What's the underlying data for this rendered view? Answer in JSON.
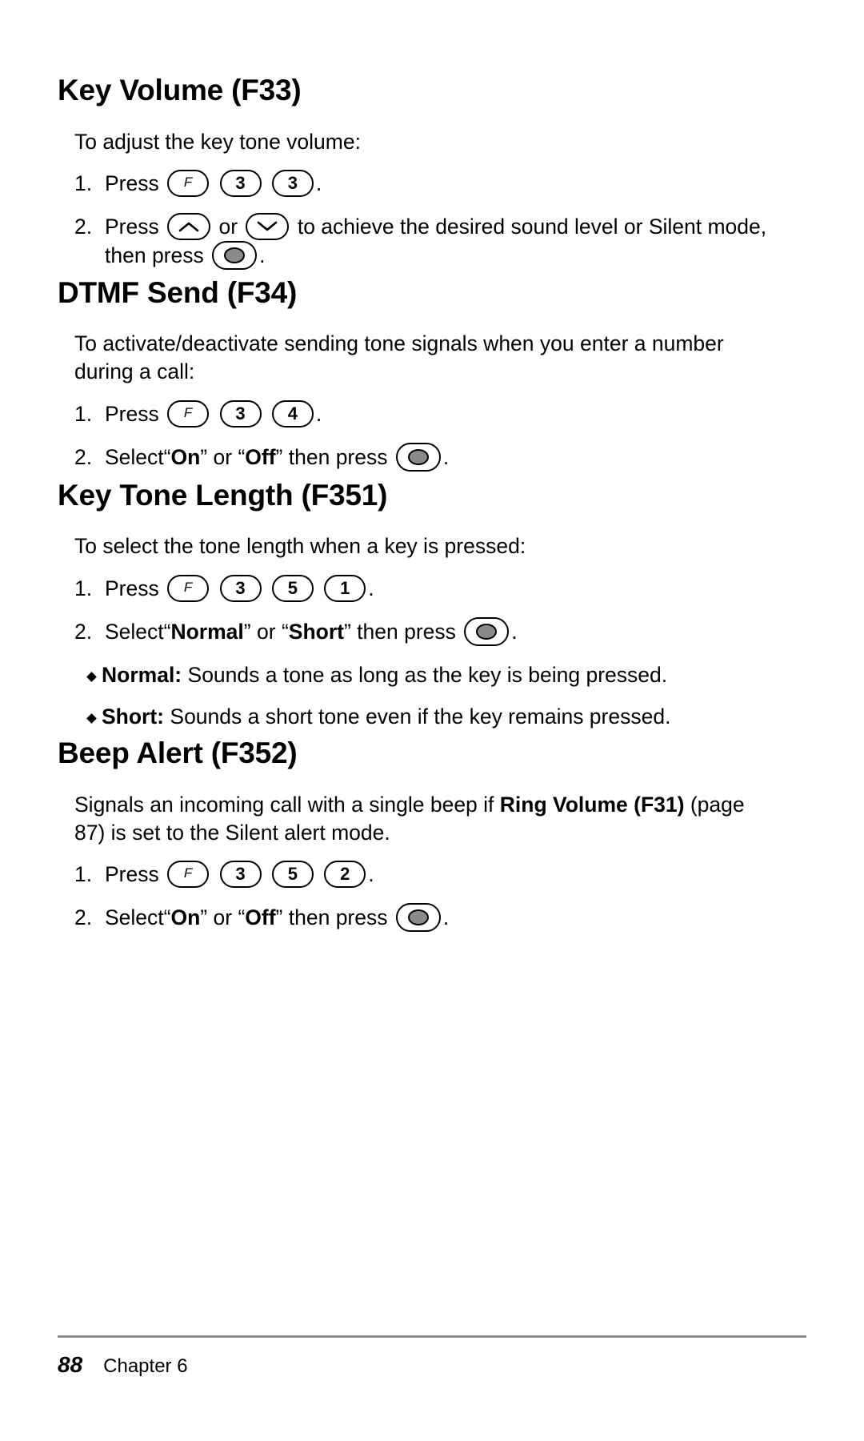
{
  "document": {
    "page_number": "88",
    "chapter_label": "Chapter 6"
  },
  "sections": [
    {
      "id": "key-volume",
      "title": "Key Volume (F33)",
      "intro": "To adjust the key tone volume:",
      "steps": [
        {
          "num": "1.",
          "pre": "Press",
          "keys": [
            "F",
            "3",
            "3"
          ],
          "post": "."
        },
        {
          "num": "2.",
          "pre": "Press",
          "keys": [
            "up",
            "down"
          ],
          "mid_or": "or",
          "post": "to achieve the desired sound level or Silent mode, then press",
          "tail": ".",
          "tail_key": "ok"
        }
      ]
    },
    {
      "id": "dtmf-send",
      "title": "DTMF Send (F34)",
      "intro": "To activate/deactivate sending tone signals when you enter a number during a call:",
      "steps": [
        {
          "num": "1.",
          "pre": "Press",
          "keys": [
            "F",
            "3",
            "4"
          ],
          "post": "."
        },
        {
          "num": "2.",
          "pre": "Select",
          "option_a": "On",
          "option_b": "Off",
          "post": "then press",
          "tail": ".",
          "tail_key": "ok"
        }
      ]
    },
    {
      "id": "key-tone-length",
      "title": "Key Tone Length (F351)",
      "intro": "To select the tone length when a key is pressed:",
      "steps": [
        {
          "num": "1.",
          "pre": "Press",
          "keys": [
            "F",
            "3",
            "5",
            "1"
          ],
          "post": "."
        },
        {
          "num": "2.",
          "pre": "Select",
          "option_a": "Normal",
          "option_b": "Short",
          "post": "then press",
          "tail": ".",
          "tail_key": "ok"
        }
      ],
      "bullets": [
        {
          "term": "Normal:",
          "text": "Sounds a tone as long as the key is being pressed."
        },
        {
          "term": "Short:",
          "text": "Sounds a short tone even if the key remains pressed."
        }
      ]
    },
    {
      "id": "beep-alert",
      "title": "Beep Alert (F352)",
      "intro_part1": "Signals an incoming call with a single beep if ",
      "intro_bold": "Ring Volume (F31)",
      "intro_part2": " (page 87) is set to the Silent alert mode.",
      "steps": [
        {
          "num": "1.",
          "pre": "Press",
          "keys": [
            "F",
            "3",
            "5",
            "2"
          ],
          "post": "."
        },
        {
          "num": "2.",
          "pre": "Select",
          "option_a": "On",
          "option_b": "Off",
          "post": "then press",
          "tail": ".",
          "tail_key": "ok"
        }
      ]
    }
  ],
  "quotes": {
    "open": "“",
    "close": "”"
  },
  "words": {
    "or": "or"
  },
  "colors": {
    "rule": "#8c8c8c",
    "key_fill": "#8a8a8a"
  }
}
